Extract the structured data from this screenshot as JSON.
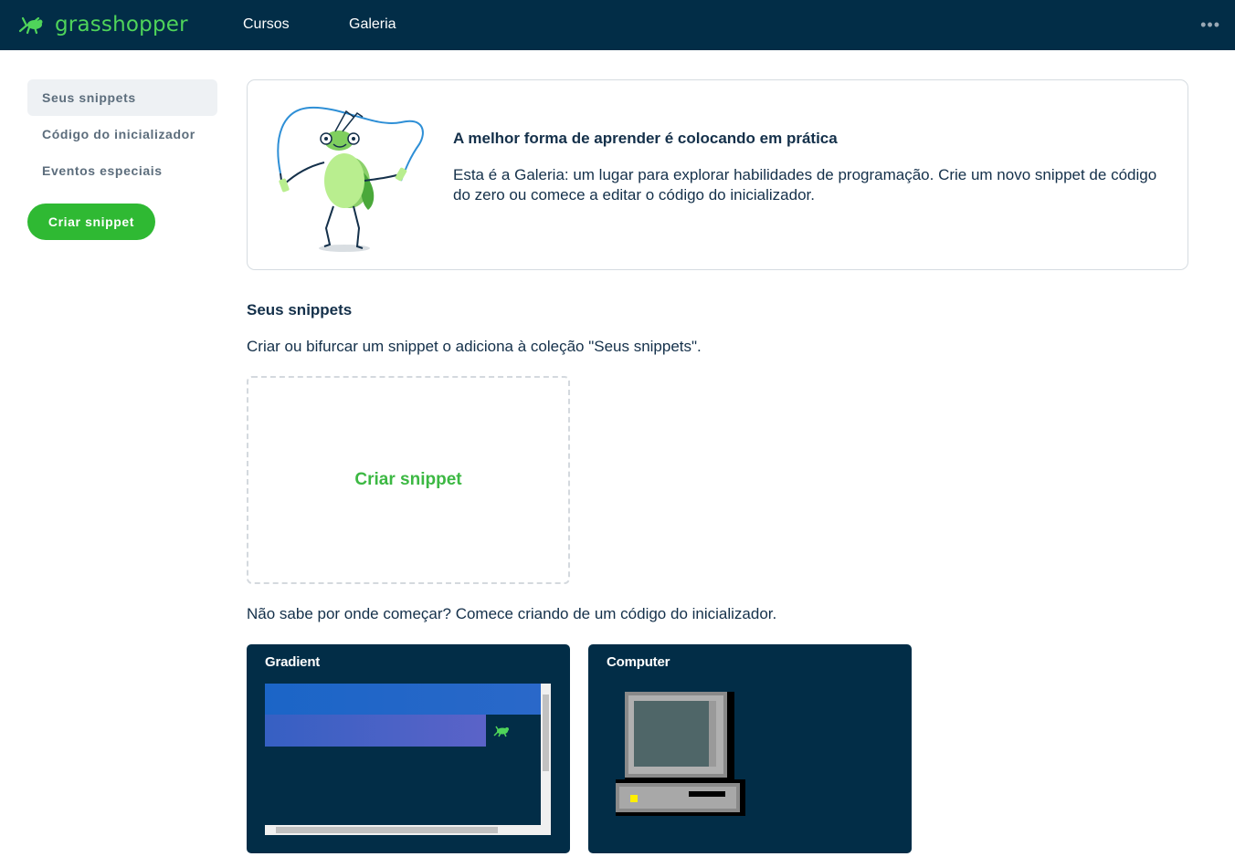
{
  "header": {
    "brand": "grasshopper",
    "nav": [
      {
        "label": "Cursos"
      },
      {
        "label": "Galeria"
      }
    ],
    "more_label": "•••"
  },
  "sidebar": {
    "items": [
      {
        "label": "Seus snippets",
        "active": true
      },
      {
        "label": "Código do inicializador",
        "active": false
      },
      {
        "label": "Eventos especiais",
        "active": false
      }
    ],
    "create_button": "Criar snippet"
  },
  "intro": {
    "title": "A melhor forma de aprender é colocando em prática",
    "text": "Esta é a Galeria: um lugar para explorar habilidades de programação. Crie um novo snippet de código do zero ou comece a editar o código do inicializador."
  },
  "snippets": {
    "title": "Seus snippets",
    "description": "Criar ou bifurcar um snippet o adiciona à coleção \"Seus snippets\".",
    "create_label": "Criar snippet"
  },
  "starters": {
    "description": "Não sabe por onde começar? Comece criando de um código do inicializador.",
    "cards": [
      {
        "title": "Gradient"
      },
      {
        "title": "Computer"
      }
    ]
  },
  "colors": {
    "nav_bg": "#022d47",
    "brand_green": "#4fd45a",
    "button_green": "#2fb933",
    "text_dark": "#14304a"
  }
}
